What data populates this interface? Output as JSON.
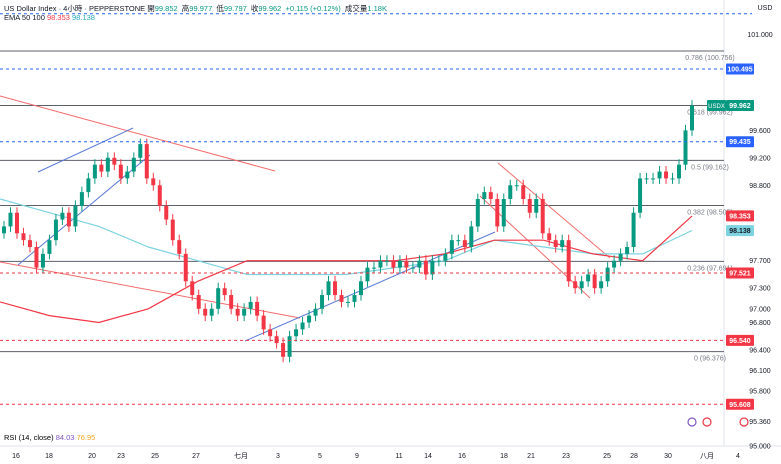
{
  "header": {
    "symbol": "US Dollar Index · 4小時 · PEPPERSTONE",
    "open_label": "開",
    "open": "99.852",
    "high_label": "高",
    "high": "99.977",
    "low_label": "低",
    "low": "99.797",
    "close_label": "收",
    "close": "99.962",
    "change": "+0.115 (+0.12%)",
    "volume_label": "成交量",
    "volume": "1.18K",
    "ema_label": "EMA 50 100",
    "ema50": "98.353",
    "ema100": "98.138"
  },
  "rsi": {
    "label": "RSI (14, close)",
    "v1": "84.03",
    "v2": "76.95"
  },
  "axis": {
    "currency": "USD",
    "ticks": [
      "101.000",
      "99.600",
      "99.200",
      "98.800",
      "97.700",
      "97.300",
      "97.000",
      "96.800",
      "96.400",
      "96.100",
      "95.800",
      "95.360",
      "95.000"
    ],
    "dates": [
      "16",
      "18",
      "20",
      "23",
      "25",
      "27",
      "七月",
      "3",
      "5",
      "9",
      "11",
      "14",
      "16",
      "18",
      "21",
      "23",
      "25",
      "28",
      "30",
      "八月",
      "4"
    ]
  },
  "colors": {
    "up": "#089981",
    "down": "#f23645",
    "ema50": "#f23645",
    "ema100": "#7dd3e0",
    "channel_blue": "#5b7bd5",
    "channel_red": "#f26b6b",
    "blue_level": "#2962ff",
    "red_level": "#f23645",
    "fib": "#787b86"
  },
  "chart_data": {
    "type": "candlestick",
    "symbol": "USDX",
    "timeframe": "4H",
    "ylim": [
      95.0,
      101.5
    ],
    "last_price": 99.962,
    "candles_close": [
      98.2,
      98.4,
      98.1,
      98.0,
      97.9,
      97.6,
      97.8,
      98.0,
      98.3,
      98.4,
      98.2,
      98.5,
      98.7,
      98.9,
      99.1,
      99.0,
      99.2,
      99.1,
      98.9,
      99.0,
      99.2,
      99.4,
      98.9,
      98.8,
      98.5,
      98.3,
      98.0,
      97.8,
      97.4,
      97.2,
      97.0,
      96.9,
      97.0,
      97.3,
      97.2,
      97.0,
      96.9,
      97.0,
      97.1,
      96.9,
      96.7,
      96.6,
      96.5,
      96.3,
      96.6,
      96.7,
      96.8,
      96.9,
      97.0,
      97.2,
      97.4,
      97.2,
      97.1,
      97.1,
      97.2,
      97.4,
      97.6,
      97.6,
      97.7,
      97.7,
      97.6,
      97.7,
      97.6,
      97.6,
      97.7,
      97.5,
      97.7,
      97.7,
      97.8,
      98.0,
      98.0,
      97.9,
      98.2,
      98.6,
      98.7,
      98.6,
      98.2,
      98.6,
      98.8,
      98.8,
      98.6,
      98.4,
      98.6,
      98.1,
      98.0,
      97.9,
      98.0,
      97.4,
      97.3,
      97.4,
      97.5,
      97.3,
      97.4,
      97.6,
      97.7,
      97.8,
      97.9,
      98.4,
      98.9,
      98.9,
      98.9,
      99.0,
      98.9,
      98.9,
      99.1,
      99.6,
      99.96
    ],
    "ema50": [
      97.1,
      96.9,
      96.8,
      97.0,
      97.4,
      97.7,
      97.7,
      97.7,
      97.7,
      97.8,
      98.0,
      98.0,
      97.8,
      97.7,
      98.35
    ],
    "ema100": [
      98.6,
      98.4,
      98.2,
      97.9,
      97.7,
      97.5,
      97.5,
      97.5,
      97.6,
      97.7,
      98.0,
      97.9,
      97.8,
      97.8,
      98.14
    ],
    "price_levels": [
      {
        "label": "100.495",
        "value": 100.495,
        "color": "#2962ff"
      },
      {
        "label": "99.435",
        "value": 99.435,
        "color": "#2962ff"
      },
      {
        "label": "98.353",
        "value": 98.353,
        "color": "#f23645"
      },
      {
        "label": "98.138",
        "value": 98.138,
        "color": "#7dd3e0"
      },
      {
        "label": "97.521",
        "value": 97.521,
        "color": "#f23645"
      },
      {
        "label": "96.540",
        "value": 96.54,
        "color": "#f23645"
      },
      {
        "label": "95.608",
        "value": 95.608,
        "color": "#f23645"
      }
    ],
    "fib_levels": [
      {
        "label": "0.786 (100.756)",
        "value": 100.756
      },
      {
        "label": "0.618 (99.962)",
        "value": 99.962
      },
      {
        "label": "0.5 (99.162)",
        "value": 99.162
      },
      {
        "label": "0.382 (98.505)",
        "value": 98.505
      },
      {
        "label": "0.236 (97.691)",
        "value": 97.691
      },
      {
        "label": "0 (96.376)",
        "value": 96.376
      }
    ],
    "top_dashed_level": 101.3
  }
}
